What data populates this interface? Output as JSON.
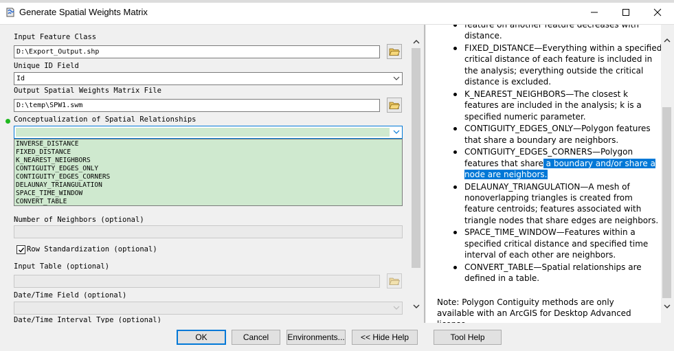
{
  "window": {
    "title": "Generate Spatial Weights Matrix"
  },
  "form": {
    "input_feature_class": {
      "label": "Input Feature Class",
      "value": "D:\\Export_Output.shp"
    },
    "unique_id_field": {
      "label": "Unique ID Field",
      "value": "Id"
    },
    "output_matrix_file": {
      "label": "Output Spatial Weights Matrix File",
      "value": "D:\\temp\\SPW1.swm"
    },
    "conceptualization": {
      "label": "Conceptualization of Spatial Relationships",
      "value": "",
      "options": [
        "INVERSE_DISTANCE",
        "FIXED_DISTANCE",
        "K_NEAREST_NEIGHBORS",
        "CONTIGUITY_EDGES_ONLY",
        "CONTIGUITY_EDGES_CORNERS",
        "DELAUNAY_TRIANGULATION",
        "SPACE_TIME_WINDOW",
        "CONVERT_TABLE"
      ]
    },
    "number_of_neighbors": {
      "label": "Number of Neighbors (optional)",
      "value": ""
    },
    "row_standardization": {
      "label": "Row Standardization (optional)",
      "checked": true
    },
    "input_table": {
      "label": "Input Table (optional)",
      "value": ""
    },
    "date_time_field": {
      "label": "Date/Time Field (optional)",
      "value": ""
    },
    "date_time_interval_type": {
      "label": "Date/Time Interval Type (optional)"
    }
  },
  "help": {
    "intro_fragment": "feature on another feature decreases with distance.",
    "items": [
      "FIXED_DISTANCE—Everything within a specified critical distance of each feature is included in the analysis; everything outside the critical distance is excluded.",
      "K_NEAREST_NEIGHBORS—The closest k features are included in the analysis; k is a specified numeric parameter.",
      "CONTIGUITY_EDGES_ONLY—Polygon features that share a boundary are neighbors.",
      "DELAUNAY_TRIANGULATION—A mesh of nonoverlapping triangles is created from feature centroids; features associated with triangle nodes that share edges are neighbors.",
      "SPACE_TIME_WINDOW—Features within a specified critical distance and specified time interval of each other are neighbors.",
      "CONVERT_TABLE—Spatial relationships are defined in a table."
    ],
    "corners_item": {
      "before": "CONTIGUITY_EDGES_CORNERS—Polygon features that share",
      "highlighted": " a boundary and/or share a node are neighbors."
    },
    "note": "Note: Polygon Contiguity methods are only available with an ArcGIS for Desktop Advanced license."
  },
  "buttons": {
    "ok": "OK",
    "cancel": "Cancel",
    "environments": "Environments...",
    "hide_help": "<< Hide Help",
    "tool_help": "Tool Help"
  },
  "colors": {
    "dropdown_bg": "#cfe9cf",
    "selection_bg": "#0078d7",
    "required_dot": "#1fb81f"
  }
}
